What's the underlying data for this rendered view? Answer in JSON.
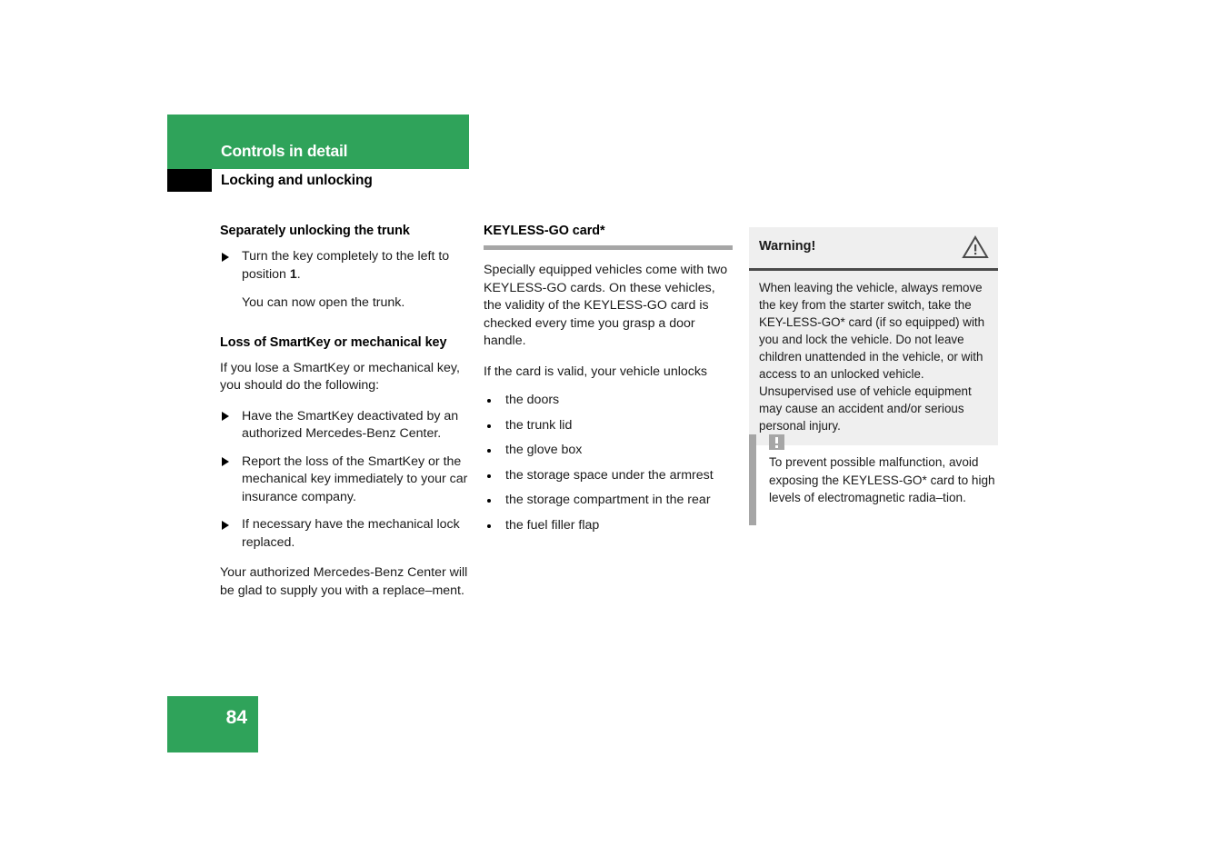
{
  "header": {
    "chapter": "Controls in detail",
    "section": "Locking and unlocking"
  },
  "left_column": {
    "heading1": "Separately unlocking the trunk",
    "steps": [
      "Turn the key completely to the left to position 1."
    ],
    "step_note": "You can now open the trunk.",
    "heading2": "Loss of SmartKey or mechanical key",
    "intro": "If you lose a SmartKey or mechanical key, you should do the following:",
    "actions": [
      "Have the SmartKey deactivated by an authorized Mercedes-Benz Center.",
      "Report the loss of the SmartKey or the mechanical key immediately to your car insurance company.",
      "If necessary have the mechanical lock replaced."
    ],
    "closing": "Your authorized Mercedes-Benz Center will be glad to supply you with a replace–ment."
  },
  "middle_column": {
    "heading": "KEYLESS-GO card*",
    "paragraph1": "Specially equipped vehicles come with two KEYLESS-GO cards. On these vehicles, the validity of the KEYLESS-GO card is checked every time you grasp a door handle.",
    "paragraph2": "If the card is valid, your vehicle unlocks",
    "unlock_items": [
      "the doors",
      "the trunk lid",
      "the glove box",
      "the storage space under the armrest",
      "the storage compartment in the rear",
      "the fuel filler flap"
    ]
  },
  "right_column": {
    "warning": {
      "title": "Warning!",
      "icon": "warning-triangle-icon",
      "body": "When leaving the vehicle, always remove the key from the starter switch, take the KEY-LESS-GO* card (if so equipped) with you and lock the vehicle. Do not leave children unattended in the vehicle, or with access to an unlocked vehicle. Unsupervised use of vehicle equipment may cause an accident and/or serious personal injury."
    },
    "note": {
      "icon": "exclamation-box-icon",
      "body": "To prevent possible malfunction, avoid exposing the KEYLESS-GO* card to high levels of electromagnetic radia–tion."
    }
  },
  "footer": {
    "page_number": "84"
  },
  "colors": {
    "brand_green": "#2fa35a",
    "warning_bg": "#efefef",
    "rule_gray": "#a6a6a6",
    "divider_dark": "#4a4a4a"
  }
}
